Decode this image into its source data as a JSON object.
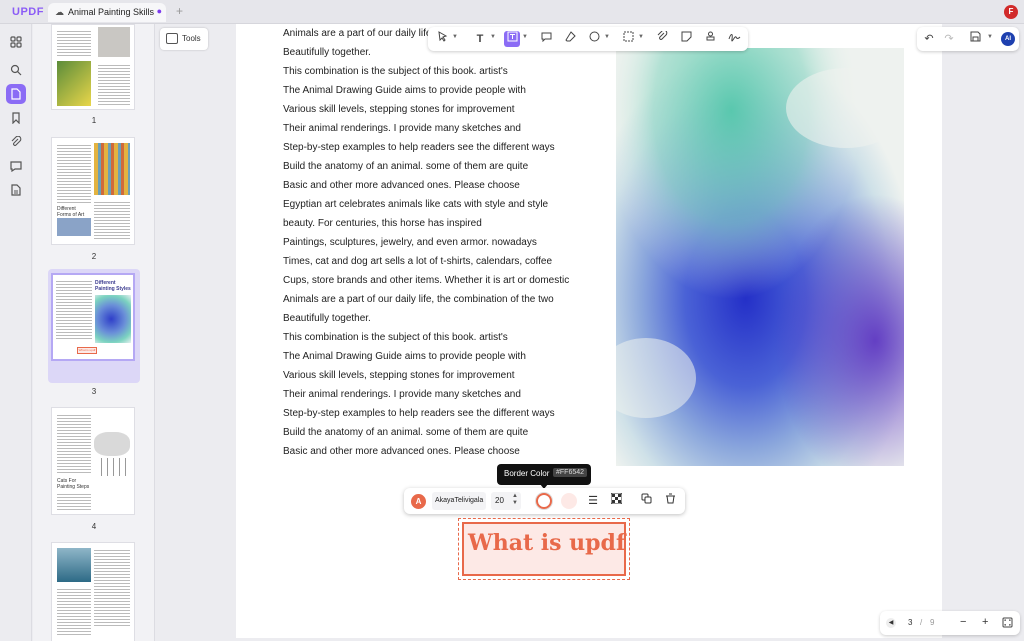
{
  "app": {
    "logo": "UPDF",
    "tab_title": "Animal Painting Skills",
    "new_tab": "+",
    "user_initial": "F"
  },
  "tools_label": "Tools",
  "thumbnails": [
    {
      "page": "1"
    },
    {
      "page": "2"
    },
    {
      "page": "3"
    },
    {
      "page": "4"
    }
  ],
  "thumb_titles": {
    "p2": "Different Forms of Art Work",
    "p3": "Different Painting Styles",
    "p4": "Cats For Painting Steps",
    "p3_chip": "What is updf"
  },
  "body_lines": [
    "Animals are a part of our daily life",
    "Beautifully together.",
    "This combination is the subject of this book. artist's",
    "The Animal Drawing Guide aims to provide people with",
    "Various skill levels, stepping stones for improvement",
    "Their animal renderings. I provide many sketches and",
    "Step-by-step examples to help readers see the different ways",
    "Build the anatomy of an animal. some of them are quite",
    "Basic and other more advanced ones. Please choose",
    "Egyptian art celebrates animals like cats with style and style",
    "beauty. For centuries, this horse has inspired",
    "Paintings, sculptures, jewelry, and even armor. nowadays",
    "Times, cat and dog art sells a lot of t-shirts, calendars, coffee",
    "Cups, store brands and other items. Whether it is art or domestic",
    "Animals are a part of our daily life, the combination of the two",
    "Beautifully together.",
    "This combination is the subject of this book. artist's",
    "The Animal Drawing Guide aims to provide people with",
    "Various skill levels, stepping stones for improvement",
    "Their animal renderings. I provide many sketches and",
    "Step-by-step examples to help readers see the different ways",
    "Build the anatomy of an animal. some of them are quite",
    "Basic and other more advanced ones. Please choose"
  ],
  "tooltip": {
    "label": "Border Color",
    "hex": "#FF6542"
  },
  "propbar": {
    "font": "AkayaTelivigala",
    "size": "20",
    "color_initial": "A"
  },
  "textbox": {
    "text": "What is updf"
  },
  "pager": {
    "current": "3",
    "separator": "/",
    "total": "9",
    "minus": "−",
    "plus": "+"
  },
  "colors": {
    "accent": "#8b6cf5",
    "annotation": "#e8694a",
    "annotation_fill": "#fde9e6"
  }
}
